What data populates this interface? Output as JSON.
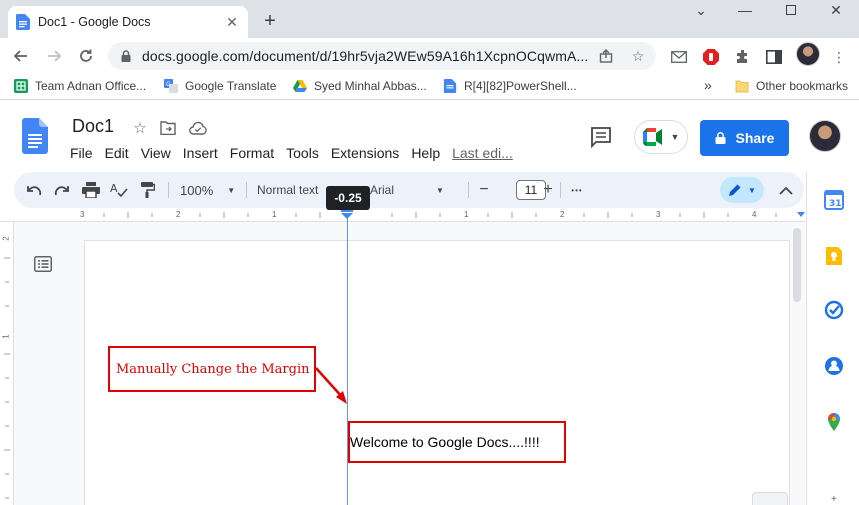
{
  "browser": {
    "tab_title": "Doc1 - Google Docs",
    "url": "docs.google.com/document/d/19hr5vja2WEw59A16h1XcpnOCqwmA...",
    "bookmarks": [
      {
        "label": "Team Adnan Office..."
      },
      {
        "label": "Google Translate"
      },
      {
        "label": "Syed Minhal Abbas..."
      },
      {
        "label": "R[4][82]PowerShell..."
      }
    ],
    "bookmarks_overflow": "»",
    "other_bookmarks": "Other bookmarks"
  },
  "docs": {
    "title": "Doc1",
    "menu": [
      "File",
      "Edit",
      "View",
      "Insert",
      "Format",
      "Tools",
      "Extensions",
      "Help"
    ],
    "last_edit": "Last edi...",
    "share_label": "Share"
  },
  "toolbar": {
    "zoom": "100%",
    "style": "Normal text",
    "font": "Arial",
    "font_size": "11",
    "minus": "−",
    "plus": "+",
    "more": "•••"
  },
  "ruler": {
    "tooltip": "-0.25",
    "labels": [
      "3",
      "2",
      "1",
      "1",
      "2",
      "3",
      "4"
    ]
  },
  "vruler": {
    "labels": [
      "2",
      "1"
    ]
  },
  "document": {
    "annotation": "Manually Change the Margin",
    "body_text": "Welcome to Google Docs....!!!!"
  },
  "colors": {
    "share_blue": "#1a73e8",
    "annotation_red": "#e00000",
    "toolbar_bg": "#edf2fa"
  }
}
